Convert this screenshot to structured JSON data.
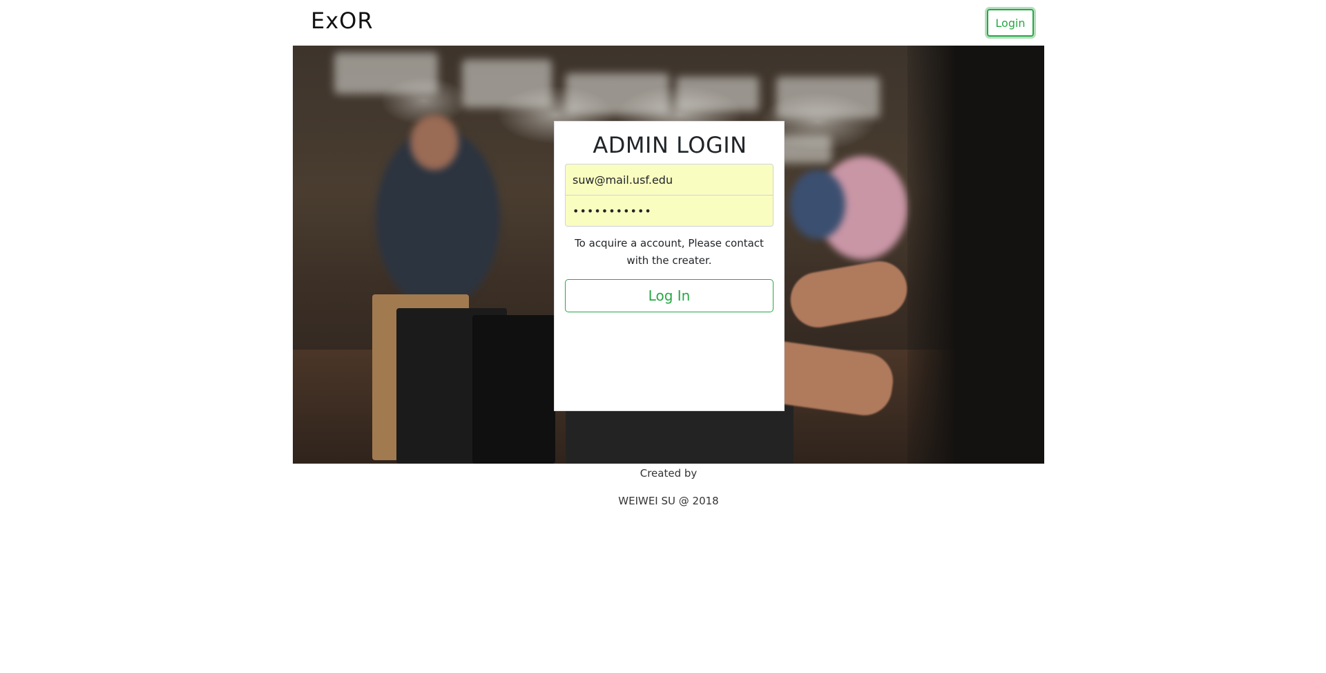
{
  "header": {
    "logo_text": "ExOR",
    "login_button": "Login"
  },
  "hero": {
    "image_description_icon": "restaurant-photo"
  },
  "login_card": {
    "title": "ADMIN LOGIN",
    "email_value": "suw@mail.usf.edu",
    "password_value": "•••••••••••",
    "hint": "To acquire a account, Please contact with the creater.",
    "submit_label": "Log In"
  },
  "footer": {
    "line1": "Created by",
    "line2": "WEIWEI SU @ 2018"
  },
  "colors": {
    "accent": "#28a745",
    "autofill": "#fafdc0"
  }
}
